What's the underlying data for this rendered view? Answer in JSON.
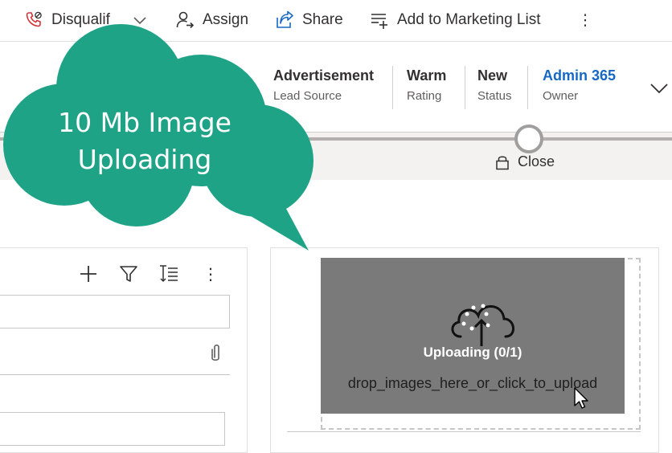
{
  "command_bar": {
    "disqualify_label": "Disqualif",
    "assign_label": "Assign",
    "share_label": "Share",
    "marketing_label": "Add to Marketing List",
    "more_label": "⋮"
  },
  "header": {
    "fields": [
      {
        "value": "Advertisement",
        "label": "Lead Source"
      },
      {
        "value": "Warm",
        "label": "Rating"
      },
      {
        "value": "New",
        "label": "Status"
      },
      {
        "value": "Admin 365",
        "label": "Owner"
      }
    ]
  },
  "process": {
    "stage_label": "Close"
  },
  "timeline": {
    "more_label": "⋮"
  },
  "upload": {
    "status": "Uploading (0/1)",
    "hint": "drop_images_here_or_click_to_upload"
  },
  "callout": {
    "line1": "10 Mb Image",
    "line2": "Uploading",
    "color": "#1fa387"
  },
  "colors": {
    "owner_link": "#1768c4",
    "dropzone_bg": "#7a7a7a"
  }
}
